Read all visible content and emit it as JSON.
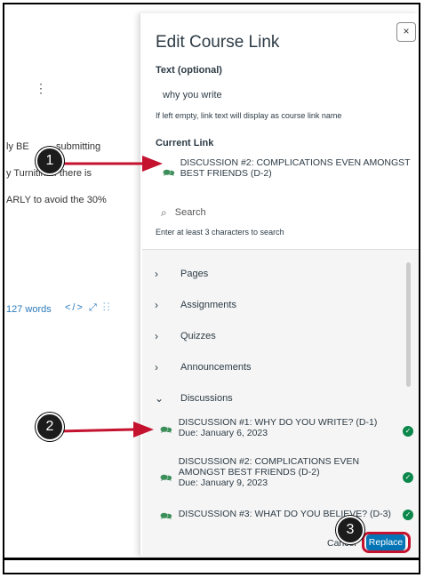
{
  "background": {
    "lines": [
      "ly BE",
      "submitting",
      "y Turnitin. If there is",
      "ARLY to avoid the 30%"
    ],
    "word_count": "127 words",
    "toolbar_glyphs": "</>  ⤢  ⋮⋮"
  },
  "dialog": {
    "title": "Edit Course Link",
    "close": "×",
    "text_label": "Text (optional)",
    "text_value": "why you write",
    "text_hint": "If left empty, link text will display as course link name",
    "current_link_label": "Current Link",
    "current_link": "DISCUSSION #2: COMPLICATIONS EVEN AMONGST BEST FRIENDS (D-2)",
    "search_placeholder": "Search",
    "search_hint": "Enter at least 3 characters to search",
    "groups": {
      "pages": "Pages",
      "assignments": "Assignments",
      "quizzes": "Quizzes",
      "announcements": "Announcements",
      "discussions": "Discussions"
    },
    "discussions": [
      {
        "title": "DISCUSSION #1: WHY DO YOU WRITE? (D-1)",
        "due": "Due: January 6, 2023"
      },
      {
        "title": "DISCUSSION #2: COMPLICATIONS EVEN AMONGST BEST FRIENDS (D-2)",
        "due": "Due: January 9, 2023"
      },
      {
        "title": "DISCUSSION #3: WHAT DO YOU BELIEVE? (D-3)",
        "due": ""
      }
    ],
    "cancel": "Cancel",
    "replace": "Replace"
  },
  "annotations": {
    "step1": "1",
    "step2": "2",
    "step3": "3"
  },
  "colors": {
    "accent": "#0374b5",
    "arrow": "#c4122f",
    "check": "#0b874b"
  }
}
